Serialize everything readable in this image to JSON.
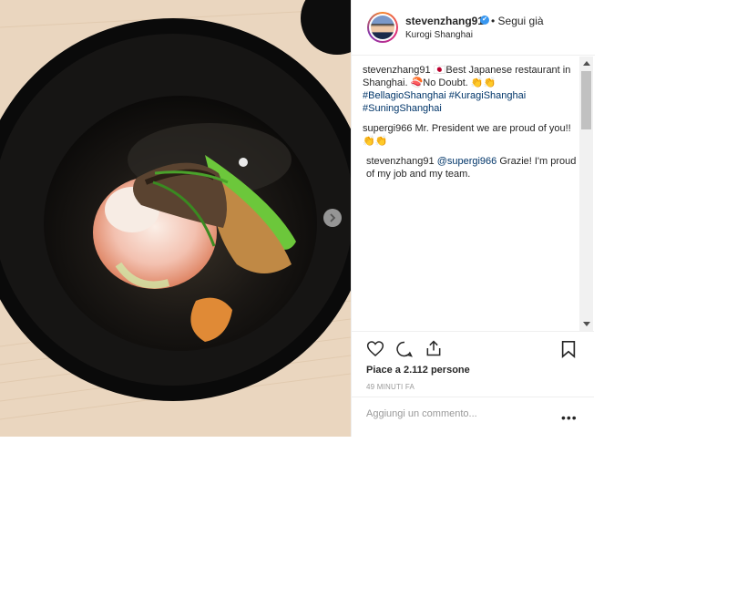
{
  "post": {
    "username": "stevenzhang91",
    "verified_glyph": "✔",
    "follow_status": "• Segui già",
    "location": "Kurogi Shanghai",
    "caption": {
      "user": "stevenzhang91",
      "text": " 🇯🇵Best Japanese restaurant in Shanghai. 🍣No Doubt. 👏👏",
      "hashtags": "#BellagioShanghai #KuragiShanghai #SuningShanghai"
    },
    "comments": [
      {
        "user": "supergi966",
        "text": " Mr. President we are proud of you!! 👏👏"
      },
      {
        "user": "stevenzhang91",
        "mention": "@supergi966",
        "text": " Grazie! I'm proud of my job and my team."
      }
    ],
    "likes": "Piace a 2.112 persone",
    "time": "49 MINUTI FA",
    "comment_placeholder": "Aggiungi un commento...",
    "more_options": "•••"
  },
  "icons": [
    "heart-icon",
    "comment-icon",
    "share-icon",
    "bookmark-icon",
    "chevron-right-icon",
    "verified-icon"
  ],
  "colors": {
    "link": "#003569",
    "verified": "#3897f0",
    "text": "#262626",
    "muted": "#999999"
  }
}
